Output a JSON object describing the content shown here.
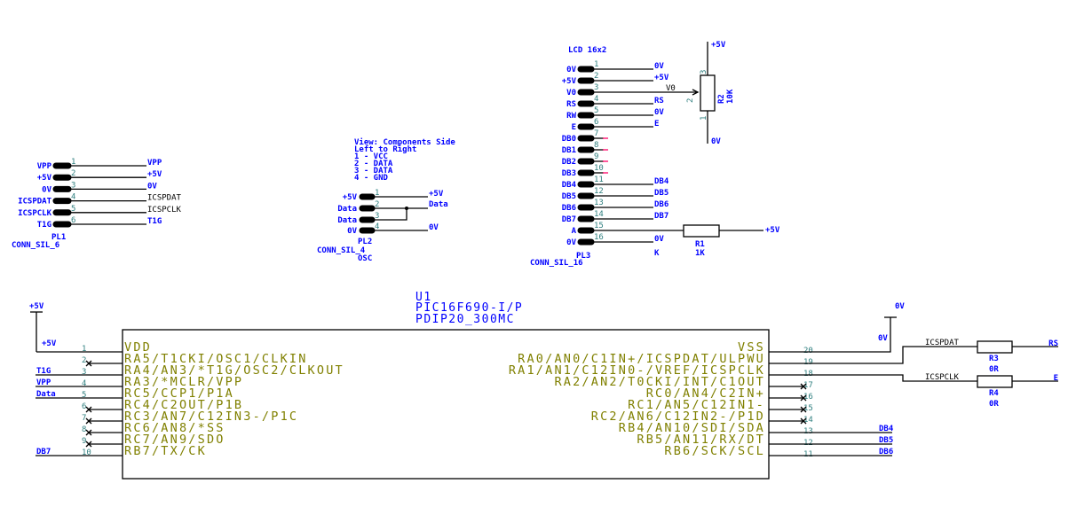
{
  "colors": {
    "label": "#0000ff",
    "pin_name": "#808000",
    "pin_number": "#2f7f7f",
    "wire": "#000000",
    "no_connect": "#ff0066"
  },
  "pl1": {
    "ref": "PL1",
    "footprint": "CONN_SIL_6",
    "pins": [
      {
        "num": "1",
        "left": "VPP",
        "right": "VPP"
      },
      {
        "num": "2",
        "left": "+5V",
        "right": "+5V"
      },
      {
        "num": "3",
        "left": "0V",
        "right": "0V"
      },
      {
        "num": "4",
        "left": "ICSPDAT",
        "right": "ICSPDAT"
      },
      {
        "num": "5",
        "left": "ICSPCLK",
        "right": "ICSPCLK"
      },
      {
        "num": "6",
        "left": "T1G",
        "right": "T1G"
      }
    ]
  },
  "pl2": {
    "ref": "PL2",
    "footprint": "CONN_SIL_4",
    "value": "OSC",
    "notes": [
      "View: Components Side",
      "Left to Right",
      "1 - VCC",
      "2 - DATA",
      "3 - DATA",
      "4 - GND"
    ],
    "pins": [
      {
        "num": "1",
        "left": "+5V",
        "right": "+5V"
      },
      {
        "num": "2",
        "left": "Data",
        "right": "Data"
      },
      {
        "num": "3",
        "left": "Data",
        "right": ""
      },
      {
        "num": "4",
        "left": "0V",
        "right": "0V"
      }
    ]
  },
  "pl3": {
    "title": "LCD 16x2",
    "ref": "PL3",
    "footprint": "CONN_SIL_16",
    "pins": [
      {
        "num": "1",
        "left": "0V",
        "right": "0V"
      },
      {
        "num": "2",
        "left": "+5V",
        "right": "+5V"
      },
      {
        "num": "3",
        "left": "V0",
        "right": "V0"
      },
      {
        "num": "4",
        "left": "RS",
        "right": "RS"
      },
      {
        "num": "5",
        "left": "RW",
        "right": "0V"
      },
      {
        "num": "6",
        "left": "E",
        "right": "E"
      },
      {
        "num": "7",
        "left": "DB0",
        "right": ""
      },
      {
        "num": "8",
        "left": "DB1",
        "right": ""
      },
      {
        "num": "9",
        "left": "DB2",
        "right": ""
      },
      {
        "num": "10",
        "left": "DB3",
        "right": ""
      },
      {
        "num": "11",
        "left": "DB4",
        "right": "DB4"
      },
      {
        "num": "12",
        "left": "DB5",
        "right": "DB5"
      },
      {
        "num": "13",
        "left": "DB6",
        "right": "DB6"
      },
      {
        "num": "14",
        "left": "DB7",
        "right": "DB7"
      },
      {
        "num": "15",
        "left": "A",
        "right": ""
      },
      {
        "num": "16",
        "left": "0V",
        "right": "0V"
      }
    ],
    "k_label": "K"
  },
  "r1": {
    "ref": "R1",
    "value": "1K",
    "net": "+5V"
  },
  "r2": {
    "ref": "R2",
    "value": "10K",
    "top": "+5V",
    "bottom": "0V",
    "pin_top": "3",
    "pin_wiper": "2",
    "pin_bottom": "1"
  },
  "r3": {
    "ref": "R3",
    "value": "0R",
    "left_net": "ICSPDAT",
    "right_net": "RS"
  },
  "r4": {
    "ref": "R4",
    "value": "0R",
    "left_net": "ICSPCLK",
    "right_net": "E"
  },
  "u1": {
    "ref": "U1",
    "part": "PIC16F690-I/P",
    "package": "PDIP20_300MC",
    "power_left": "+5V",
    "power_right": "0V",
    "left_pins": [
      {
        "num": "1",
        "name": "VDD",
        "net": "+5V"
      },
      {
        "num": "2",
        "name": "RA5/T1CKI/OSC1/CLKIN",
        "net": ""
      },
      {
        "num": "3",
        "name": "RA4/AN3/*T1G/OSC2/CLKOUT",
        "net": "T1G"
      },
      {
        "num": "4",
        "name": "RA3/*MCLR/VPP",
        "net": "VPP"
      },
      {
        "num": "5",
        "name": "RC5/CCP1/P1A",
        "net": "Data"
      },
      {
        "num": "6",
        "name": "RC4/C2OUT/P1B",
        "net": ""
      },
      {
        "num": "7",
        "name": "RC3/AN7/C12IN3-/P1C",
        "net": ""
      },
      {
        "num": "8",
        "name": "RC6/AN8/*SS",
        "net": ""
      },
      {
        "num": "9",
        "name": "RC7/AN9/SDO",
        "net": ""
      },
      {
        "num": "10",
        "name": "RB7/TX/CK",
        "net": "DB7"
      }
    ],
    "right_pins": [
      {
        "num": "20",
        "name": "VSS",
        "net": "0V"
      },
      {
        "num": "19",
        "name": "RA0/AN0/C1IN+/ICSPDAT/ULPWU",
        "net": ""
      },
      {
        "num": "18",
        "name": "RA1/AN1/C12IN0-/VREF/ICSPCLK",
        "net": ""
      },
      {
        "num": "17",
        "name": "RA2/AN2/T0CKI/INT/C1OUT",
        "net": ""
      },
      {
        "num": "16",
        "name": "RC0/AN4/C2IN+",
        "net": ""
      },
      {
        "num": "15",
        "name": "RC1/AN5/C12IN1-",
        "net": ""
      },
      {
        "num": "14",
        "name": "RC2/AN6/C12IN2-/P1D",
        "net": ""
      },
      {
        "num": "13",
        "name": "RB4/AN10/SDI/SDA",
        "net": "DB4"
      },
      {
        "num": "12",
        "name": "RB5/AN11/RX/DT",
        "net": "DB5"
      },
      {
        "num": "11",
        "name": "RB6/SCK/SCL",
        "net": "DB6"
      }
    ]
  }
}
